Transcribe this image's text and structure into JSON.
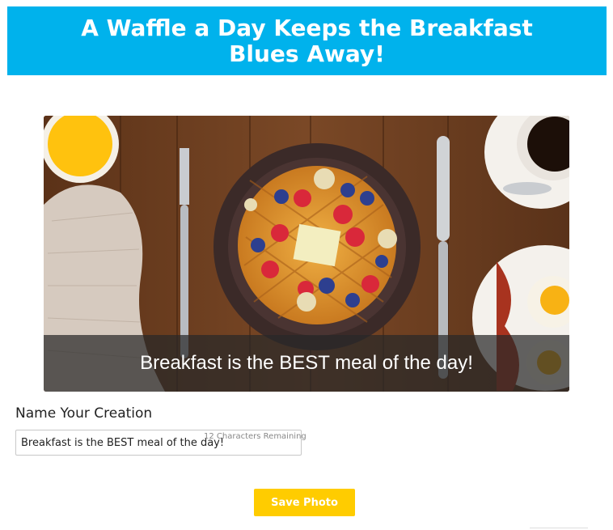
{
  "header": {
    "title": "A Waffle a Day Keeps the Breakfast Blues Away!",
    "background_color": "#00b2ec"
  },
  "photo": {
    "caption": "Breakfast is the BEST meal of the day!"
  },
  "form": {
    "name_label": "Name Your Creation",
    "name_value": "Breakfast is the BEST meal of the day!",
    "remaining_text": "12 Characters Remaining",
    "save_label": "Save Photo",
    "save_color": "#ffcc00"
  }
}
